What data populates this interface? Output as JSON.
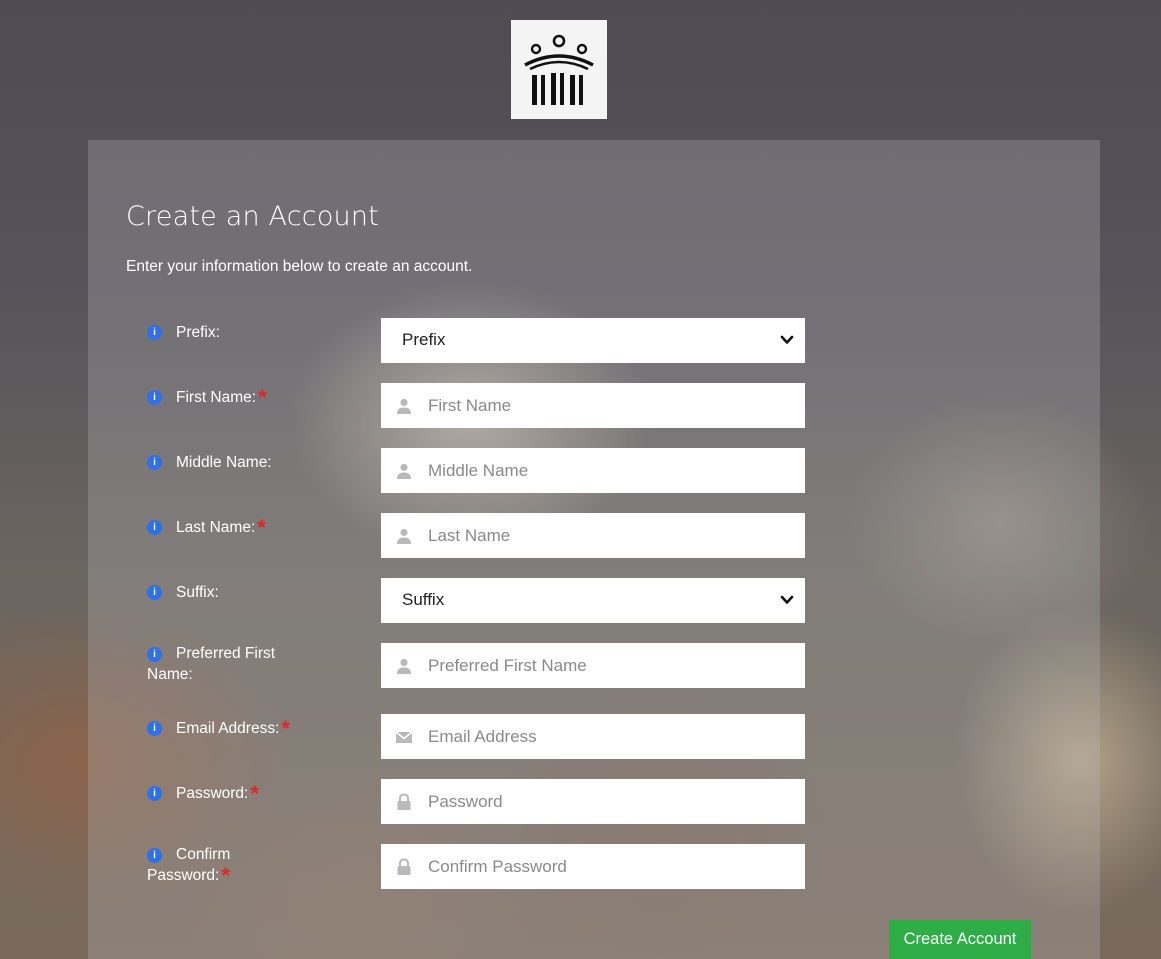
{
  "logo": {
    "icon": "institution-columns-logo"
  },
  "form": {
    "title": "Create an Account",
    "subtitle": "Enter your information below to create an account.",
    "fields": {
      "prefix": {
        "label": "Prefix:",
        "selected": "Prefix",
        "required": false
      },
      "first_name": {
        "label": "First Name:",
        "placeholder": "First Name",
        "required": true
      },
      "middle_name": {
        "label": "Middle Name:",
        "placeholder": "Middle Name",
        "required": false
      },
      "last_name": {
        "label": "Last Name:",
        "placeholder": "Last Name",
        "required": true
      },
      "suffix": {
        "label": "Suffix:",
        "selected": "Suffix",
        "required": false
      },
      "preferred_first_name": {
        "label": "Preferred First Name:",
        "placeholder": "Preferred First Name",
        "required": false
      },
      "email": {
        "label": "Email Address:",
        "placeholder": "Email Address",
        "required": true
      },
      "password": {
        "label": "Password:",
        "placeholder": "Password",
        "required": true
      },
      "confirm_password": {
        "label": "Confirm Password:",
        "placeholder": "Confirm Password",
        "required": true
      }
    },
    "required_marker": "*",
    "submit_label": "Create Account"
  },
  "colors": {
    "info_icon": "#2f6fea",
    "required": "#e3242b",
    "submit_button": "#2eac46"
  }
}
